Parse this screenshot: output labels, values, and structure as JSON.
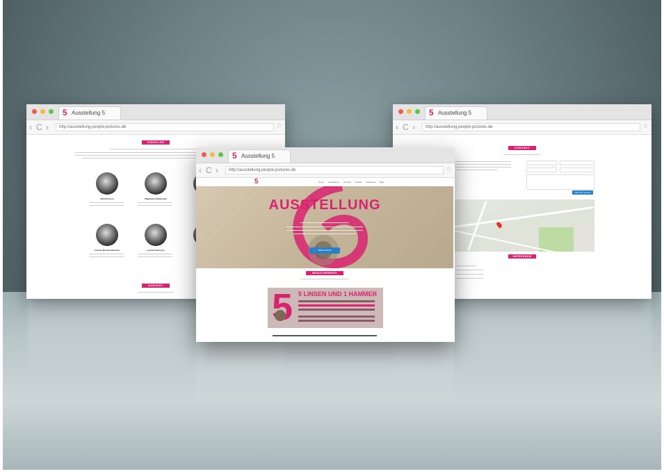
{
  "browser": {
    "tab_title": "Ausstellung 5",
    "logo_glyph": "5",
    "url": "http://ausstellung.people-pictures.de",
    "back_label": "‹",
    "forward_label": "›",
    "reload_label": "C",
    "star_label": "☆"
  },
  "left_page": {
    "section_label": "KÜNSTLER",
    "artists": [
      {
        "name": "Michael Senn"
      },
      {
        "name": "Magdalena Walkowiak"
      },
      {
        "name": ""
      },
      {
        "name": "Antonia Michael-Riemann"
      },
      {
        "name": "Gerhard Dietsche"
      },
      {
        "name": ""
      }
    ],
    "footer_label": "KONTAKT"
  },
  "center_page": {
    "nav_links": [
      "Home",
      "Ausstellung",
      "Künstler",
      "Kontakt",
      "Impressum",
      "Blog"
    ],
    "hero_title": "AUSSTELLUNG",
    "hero_button": "MEHR INFOS",
    "section_label": "BESUCHERINFO",
    "poster": {
      "number": "5",
      "headline": "5 LINSEN UND 1 HAMMER"
    }
  },
  "right_page": {
    "section_label": "KONTAKT",
    "submit_label": "Nachricht senden",
    "footer_label": "IMPRESSUM"
  },
  "colors": {
    "brand_pink": "#d8236f",
    "button_blue": "#2a80c7"
  }
}
